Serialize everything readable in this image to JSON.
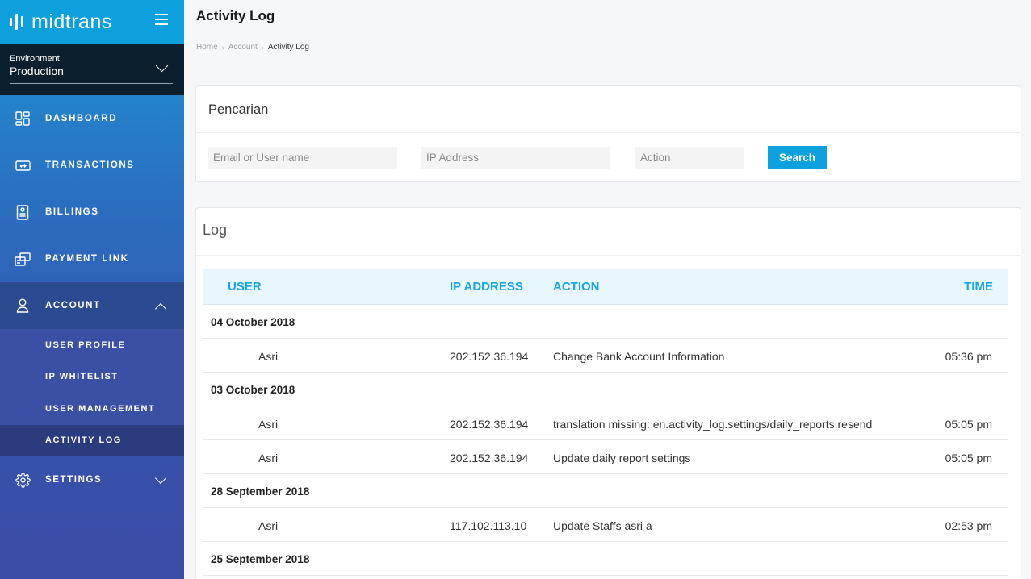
{
  "brand": {
    "name": "midtrans"
  },
  "environment": {
    "label": "Environment",
    "value": "Production"
  },
  "sidebar": {
    "items": [
      {
        "label": "DASHBOARD",
        "icon": "dashboard-icon"
      },
      {
        "label": "TRANSACTIONS",
        "icon": "transactions-icon"
      },
      {
        "label": "BILLINGS",
        "icon": "billings-icon"
      },
      {
        "label": "PAYMENT LINK",
        "icon": "payment-link-icon"
      },
      {
        "label": "ACCOUNT",
        "icon": "user-icon",
        "expanded": true
      },
      {
        "label": "SETTINGS",
        "icon": "gear-icon"
      }
    ],
    "account_sub": [
      {
        "label": "USER PROFILE"
      },
      {
        "label": "IP WHITELIST"
      },
      {
        "label": "USER MANAGEMENT"
      },
      {
        "label": "ACTIVITY LOG",
        "current": true
      }
    ]
  },
  "page": {
    "title": "Activity Log",
    "breadcrumb": [
      "Home",
      "Account",
      "Activity Log"
    ]
  },
  "search": {
    "title": "Pencarian",
    "email_placeholder": "Email or User name",
    "ip_placeholder": "IP Address",
    "action_placeholder": "Action",
    "button_label": "Search",
    "button_color": "#0ea1e0"
  },
  "log": {
    "title": "Log",
    "columns": {
      "user": "USER",
      "ip": "IP ADDRESS",
      "action": "ACTION",
      "time": "TIME"
    },
    "groups": [
      {
        "date": "04 October 2018",
        "entries": [
          {
            "user": "Asri",
            "ip": "202.152.36.194",
            "action": "Change Bank Account Information",
            "time": "05:36 pm"
          }
        ]
      },
      {
        "date": "03 October 2018",
        "entries": [
          {
            "user": "Asri",
            "ip": "202.152.36.194",
            "action": "translation missing: en.activity_log.settings/daily_reports.resend",
            "time": "05:05 pm"
          },
          {
            "user": "Asri",
            "ip": "202.152.36.194",
            "action": "Update daily report settings",
            "time": "05:05 pm"
          }
        ]
      },
      {
        "date": "28 September 2018",
        "entries": [
          {
            "user": "Asri",
            "ip": "117.102.113.10",
            "action": "Update Staffs asri a",
            "time": "02:53 pm"
          }
        ]
      },
      {
        "date": "25 September 2018",
        "entries": []
      }
    ]
  }
}
